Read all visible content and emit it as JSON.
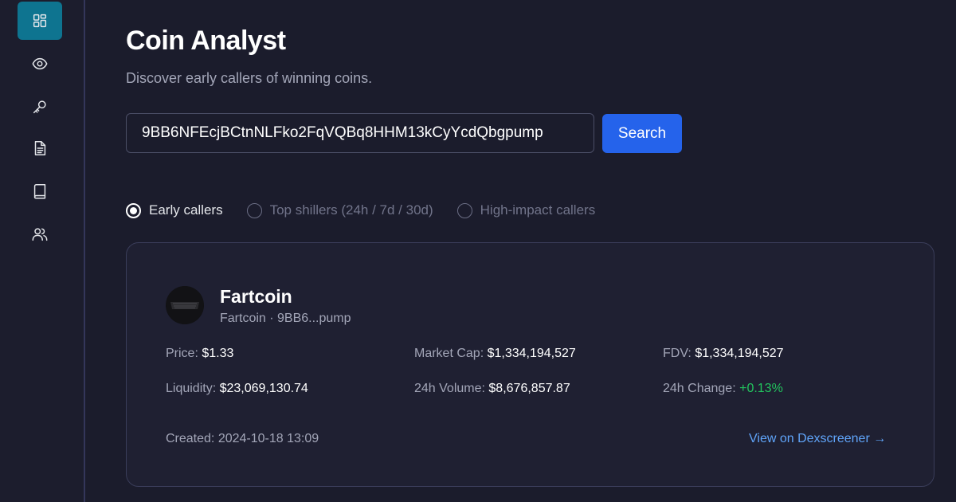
{
  "sidebar": {
    "items": [
      {
        "icon": "dashboard-icon",
        "active": true
      },
      {
        "icon": "eye-icon",
        "active": false
      },
      {
        "icon": "key-icon",
        "active": false
      },
      {
        "icon": "document-icon",
        "active": false
      },
      {
        "icon": "book-icon",
        "active": false
      },
      {
        "icon": "users-icon",
        "active": false
      }
    ],
    "active_color": "#0e7490"
  },
  "header": {
    "title": "Coin Analyst",
    "subtitle": "Discover early callers of winning coins."
  },
  "search": {
    "value": "9BB6NFEcjBCtnNLFko2FqVQBq8HHM13kCyYcdQbgpump",
    "button_label": "Search",
    "button_color": "#2563eb"
  },
  "modes": {
    "options": [
      {
        "label": "Early callers",
        "selected": true
      },
      {
        "label": "Top shillers (24h / 7d / 30d)",
        "selected": false
      },
      {
        "label": "High-impact callers",
        "selected": false
      }
    ]
  },
  "coin": {
    "name": "Fartcoin",
    "subtitle": "Fartcoin · 9BB6...pump",
    "logo_icon": "fartcoin-logo-icon",
    "stats": {
      "price_label": "Price:",
      "price": "$1.33",
      "market_cap_label": "Market Cap:",
      "market_cap": "$1,334,194,527",
      "fdv_label": "FDV:",
      "fdv": "$1,334,194,527",
      "liquidity_label": "Liquidity:",
      "liquidity": "$23,069,130.74",
      "volume_label": "24h Volume:",
      "volume": "$8,676,857.87",
      "change_label": "24h Change:",
      "change": "+0.13%",
      "change_color": "#22c55e"
    },
    "created": "Created: 2024-10-18 13:09",
    "dex_link": "View on Dexscreener →"
  }
}
